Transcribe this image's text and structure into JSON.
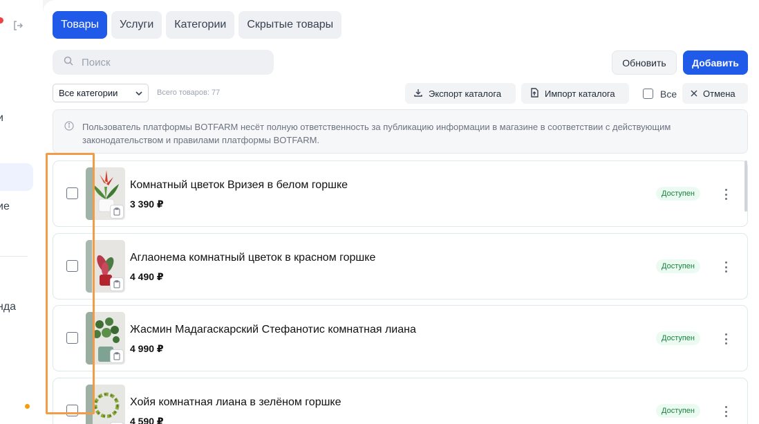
{
  "sidebar": {
    "fragments": [
      "и",
      "ие",
      "нда"
    ]
  },
  "tabs": [
    {
      "label": "Товары",
      "active": true
    },
    {
      "label": "Услуги",
      "active": false
    },
    {
      "label": "Категории",
      "active": false
    },
    {
      "label": "Скрытые товары",
      "active": false
    }
  ],
  "search": {
    "placeholder": "Поиск",
    "value": ""
  },
  "actions": {
    "refresh_label": "Обновить",
    "add_label": "Добавить"
  },
  "filter": {
    "selected_category": "Все категории",
    "total_text": "Всего товаров: 77"
  },
  "toolbar": {
    "export_label": "Экспорт каталога",
    "import_label": "Импорт каталога",
    "select_all_label": "Все",
    "cancel_label": "Отмена"
  },
  "notice": {
    "text": "Пользователь платформы BOTFARM несёт полную ответственность за публикацию информации в магазине в соответствии с действующим законодательством и правилами платформы BOTFARM."
  },
  "products": [
    {
      "name": "Комнатный цветок Вризея в белом горшке",
      "price": "3 390 ₽",
      "status": "Доступен"
    },
    {
      "name": "Аглаонема комнатный цветок в красном горшке",
      "price": "4 490 ₽",
      "status": "Доступен"
    },
    {
      "name": "Жасмин Мадагаскарский Стефанотис комнатная лиана",
      "price": "4 990 ₽",
      "status": "Доступен"
    },
    {
      "name": "Хойя комнатная лиана в зелёном горшке",
      "price": "4 590 ₽",
      "status": "Доступен"
    }
  ],
  "colors": {
    "accent": "#1f5ae8",
    "status_bg": "#ecfbf1",
    "status_text": "#15803d",
    "highlight": "#f29c48"
  }
}
